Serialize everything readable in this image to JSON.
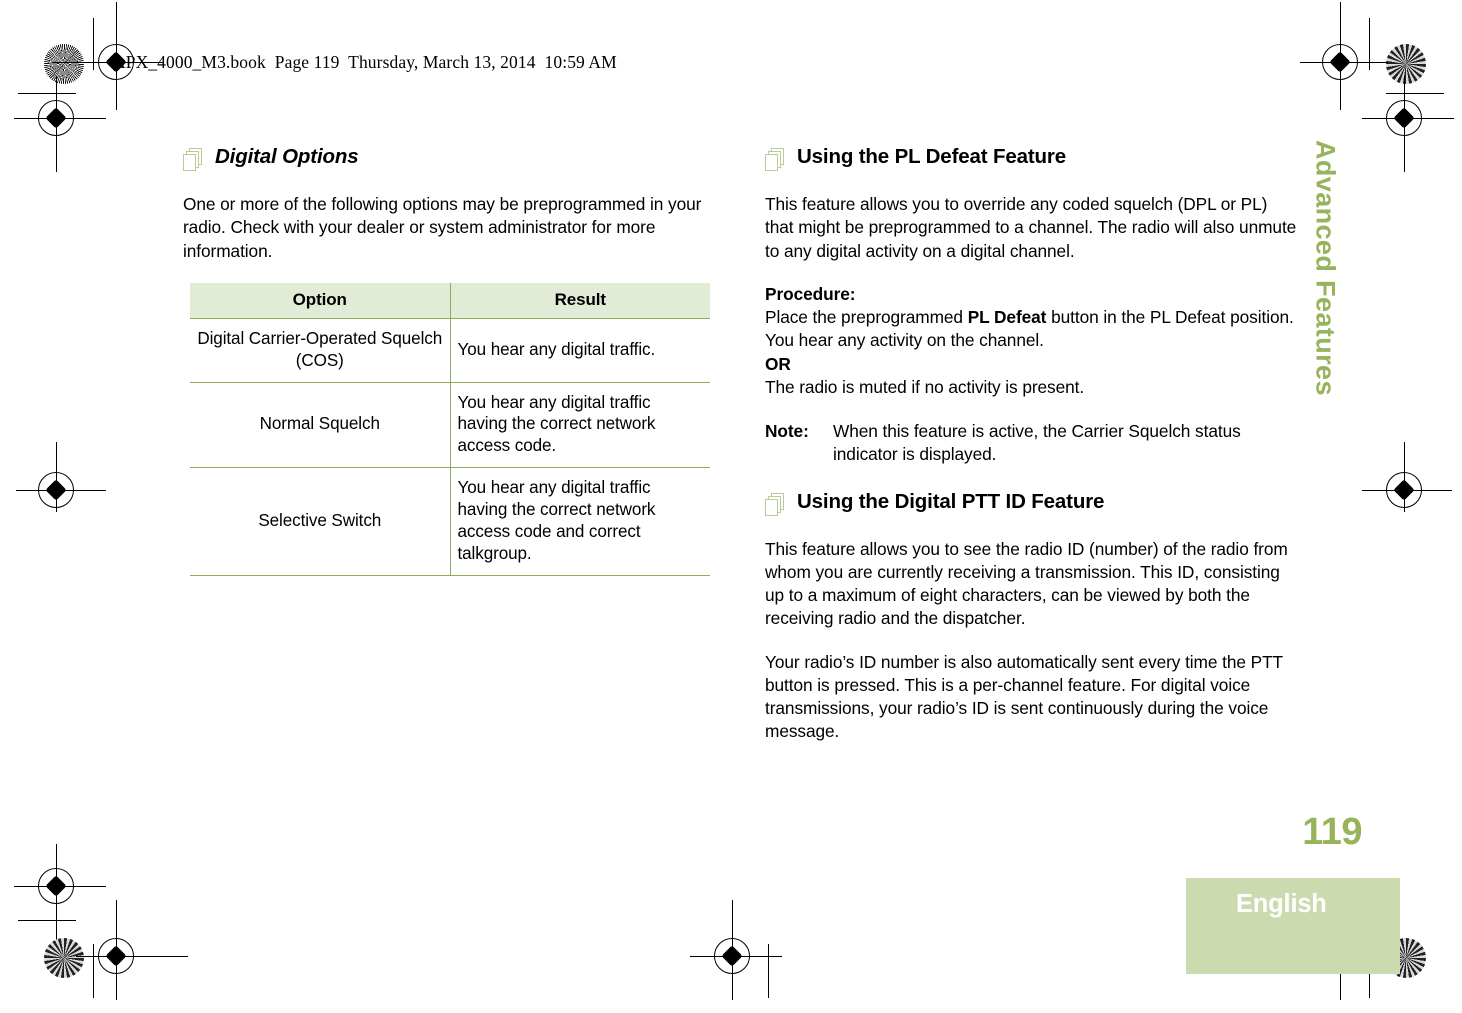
{
  "running_head": "APX_4000_M3.book  Page 119  Thursday, March 13, 2014  10:59 AM",
  "thumb_tab": {
    "label": "Advanced Features"
  },
  "folio": {
    "page_number": "119",
    "language": "English"
  },
  "colors": {
    "accent_green": "#97b45c",
    "table_header_bg": "#e2ebd5",
    "table_border": "#8fae56",
    "lang_bar_bg": "#ccdab0",
    "icon_outline": "#b9cc96"
  },
  "left_column": {
    "heading": "Digital Options",
    "intro": "One or more of the following options may be preprogrammed in your radio. Check with your dealer or system administrator for more information.",
    "table": {
      "columns": [
        "Option",
        "Result"
      ],
      "rows": [
        {
          "option": "Digital Carrier-Operated Squelch (COS)",
          "result": "You hear any digital traffic."
        },
        {
          "option": "Normal Squelch",
          "result": "You hear any digital traffic having the correct network access code."
        },
        {
          "option": "Selective Switch",
          "result": "You hear any digital traffic having the correct network access code and correct talkgroup."
        }
      ]
    }
  },
  "right_column": {
    "section_pl_defeat": {
      "heading": "Using the PL Defeat Feature",
      "intro": "This feature allows you to override any coded squelch (DPL or PL) that might be preprogrammed to a channel. The radio will also unmute to any digital activity on a digital channel.",
      "procedure_label": "Procedure:",
      "procedure_line1_pre": "Place the preprogrammed ",
      "procedure_line1_bold": "PL Defeat",
      "procedure_line1_post": " button in the PL Defeat position. You hear any activity on the channel.",
      "or_label": "OR",
      "procedure_line2": "The radio is muted if no activity is present.",
      "note_label": "Note:",
      "note_text": "When this feature is active, the Carrier Squelch status indicator is displayed."
    },
    "section_ptt_id": {
      "heading": "Using the Digital PTT ID Feature",
      "paragraph1": "This feature allows you to see the radio ID (number) of the radio from whom you are currently receiving a transmission. This ID, consisting up to a maximum of eight characters, can be viewed by both the receiving radio and the dispatcher.",
      "paragraph2": "Your radio’s ID number is also automatically sent every time the PTT button is pressed. This is a per-channel feature. For digital voice transmissions, your radio’s ID is sent continuously during the voice message."
    }
  }
}
